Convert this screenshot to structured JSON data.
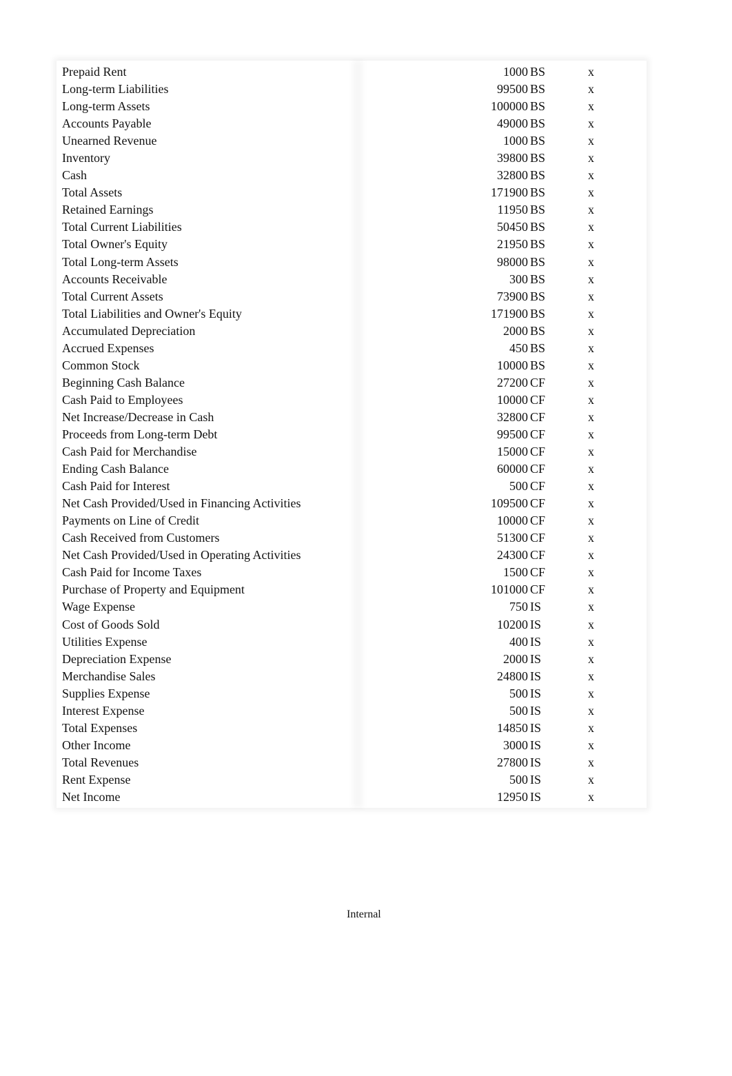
{
  "rows": [
    {
      "label": "Prepaid Rent",
      "amount": "1000",
      "statement": "BS",
      "mark": "x"
    },
    {
      "label": "Long-term Liabilities",
      "amount": "99500",
      "statement": "BS",
      "mark": "x"
    },
    {
      "label": "Long-term Assets",
      "amount": "100000",
      "statement": "BS",
      "mark": "x"
    },
    {
      "label": "Accounts Payable",
      "amount": "49000",
      "statement": "BS",
      "mark": "x"
    },
    {
      "label": "Unearned Revenue",
      "amount": "1000",
      "statement": "BS",
      "mark": "x"
    },
    {
      "label": "Inventory",
      "amount": "39800",
      "statement": "BS",
      "mark": "x"
    },
    {
      "label": "Cash",
      "amount": "32800",
      "statement": "BS",
      "mark": "x"
    },
    {
      "label": "Total Assets",
      "amount": "171900",
      "statement": "BS",
      "mark": "x"
    },
    {
      "label": "Retained Earnings",
      "amount": "11950",
      "statement": "BS",
      "mark": "x"
    },
    {
      "label": "Total Current Liabilities",
      "amount": "50450",
      "statement": "BS",
      "mark": "x"
    },
    {
      "label": "Total Owner's Equity",
      "amount": "21950",
      "statement": "BS",
      "mark": "x"
    },
    {
      "label": "Total Long-term Assets",
      "amount": "98000",
      "statement": "BS",
      "mark": "x"
    },
    {
      "label": "Accounts Receivable",
      "amount": "300",
      "statement": "BS",
      "mark": "x"
    },
    {
      "label": "Total Current Assets",
      "amount": "73900",
      "statement": "BS",
      "mark": "x"
    },
    {
      "label": "Total Liabilities and Owner's Equity",
      "amount": "171900",
      "statement": "BS",
      "mark": "x"
    },
    {
      "label": "Accumulated Depreciation",
      "amount": "2000",
      "statement": "BS",
      "mark": "x"
    },
    {
      "label": "Accrued Expenses",
      "amount": "450",
      "statement": "BS",
      "mark": "x"
    },
    {
      "label": "Common Stock",
      "amount": "10000",
      "statement": "BS",
      "mark": "x"
    },
    {
      "label": "Beginning Cash Balance",
      "amount": "27200",
      "statement": "CF",
      "mark": "x"
    },
    {
      "label": "Cash Paid to Employees",
      "amount": "10000",
      "statement": "CF",
      "mark": "x"
    },
    {
      "label": "Net Increase/Decrease in Cash",
      "amount": "32800",
      "statement": "CF",
      "mark": "x"
    },
    {
      "label": "Proceeds from Long-term Debt",
      "amount": "99500",
      "statement": "CF",
      "mark": "x"
    },
    {
      "label": "Cash Paid for Merchandise",
      "amount": "15000",
      "statement": "CF",
      "mark": "x"
    },
    {
      "label": "Ending Cash Balance",
      "amount": "60000",
      "statement": "CF",
      "mark": "x"
    },
    {
      "label": "Cash Paid for Interest",
      "amount": "500",
      "statement": "CF",
      "mark": "x"
    },
    {
      "label": "Net Cash Provided/Used in Financing Activities",
      "amount": "109500",
      "statement": "CF",
      "mark": "x"
    },
    {
      "label": "Payments on Line of Credit",
      "amount": "10000",
      "statement": "CF",
      "mark": "x"
    },
    {
      "label": "Cash Received from Customers",
      "amount": "51300",
      "statement": "CF",
      "mark": "x"
    },
    {
      "label": "Net Cash Provided/Used in Operating Activities",
      "amount": "24300",
      "statement": "CF",
      "mark": "x"
    },
    {
      "label": "Cash Paid for Income Taxes",
      "amount": "1500",
      "statement": "CF",
      "mark": "x"
    },
    {
      "label": "Purchase of Property and Equipment",
      "amount": "101000",
      "statement": "CF",
      "mark": "x"
    },
    {
      "label": "Wage Expense",
      "amount": "750",
      "statement": "IS",
      "mark": "x"
    },
    {
      "label": "Cost of Goods Sold",
      "amount": "10200",
      "statement": "IS",
      "mark": "x"
    },
    {
      "label": "Utilities Expense",
      "amount": "400",
      "statement": "IS",
      "mark": "x"
    },
    {
      "label": "Depreciation Expense",
      "amount": "2000",
      "statement": "IS",
      "mark": "x"
    },
    {
      "label": "Merchandise Sales",
      "amount": "24800",
      "statement": "IS",
      "mark": "x"
    },
    {
      "label": "Supplies Expense",
      "amount": "500",
      "statement": "IS",
      "mark": "x"
    },
    {
      "label": "Interest Expense",
      "amount": "500",
      "statement": "IS",
      "mark": "x"
    },
    {
      "label": "Total Expenses",
      "amount": "14850",
      "statement": "IS",
      "mark": "x"
    },
    {
      "label": "Other Income",
      "amount": "3000",
      "statement": "IS",
      "mark": "x"
    },
    {
      "label": "Total Revenues",
      "amount": "27800",
      "statement": "IS",
      "mark": "x"
    },
    {
      "label": "Rent Expense",
      "amount": "500",
      "statement": "IS",
      "mark": "x"
    },
    {
      "label": "Net Income",
      "amount": "12950",
      "statement": "IS",
      "mark": "x"
    }
  ],
  "footer": {
    "classification": "Internal"
  }
}
